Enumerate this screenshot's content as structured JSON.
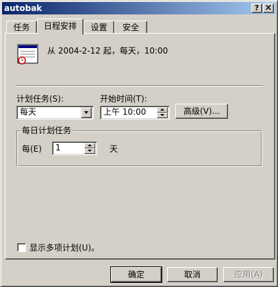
{
  "window": {
    "title": "autobak",
    "help_button": "?",
    "close_button": "×"
  },
  "tabs": [
    {
      "label": "任务",
      "active": false
    },
    {
      "label": "日程安排",
      "active": true
    },
    {
      "label": "设置",
      "active": false
    },
    {
      "label": "安全",
      "active": false
    }
  ],
  "schedule": {
    "summary": "从 2004-2-12 起，每天，10:00",
    "schedule_task_label": "计划任务(S):",
    "schedule_task_value": "每天",
    "start_time_label": "开始时间(T):",
    "start_time_value": "上午 10:00",
    "advanced_button": "高级(V)..."
  },
  "daily_group": {
    "title": "每日计划任务",
    "every_label": "每(E)",
    "every_value": "1",
    "unit_label": "天"
  },
  "multiple_schedules": {
    "label": "显示多项计划(U)。",
    "checked": false
  },
  "footer": {
    "ok": "确定",
    "cancel": "取消",
    "apply": "应用(A)"
  },
  "colors": {
    "title_gradient_start": "#0a246a",
    "title_gradient_end": "#a6caf0",
    "face": "#d4d0c8"
  },
  "icons": {
    "schedule": "calendar-clock-icon"
  }
}
